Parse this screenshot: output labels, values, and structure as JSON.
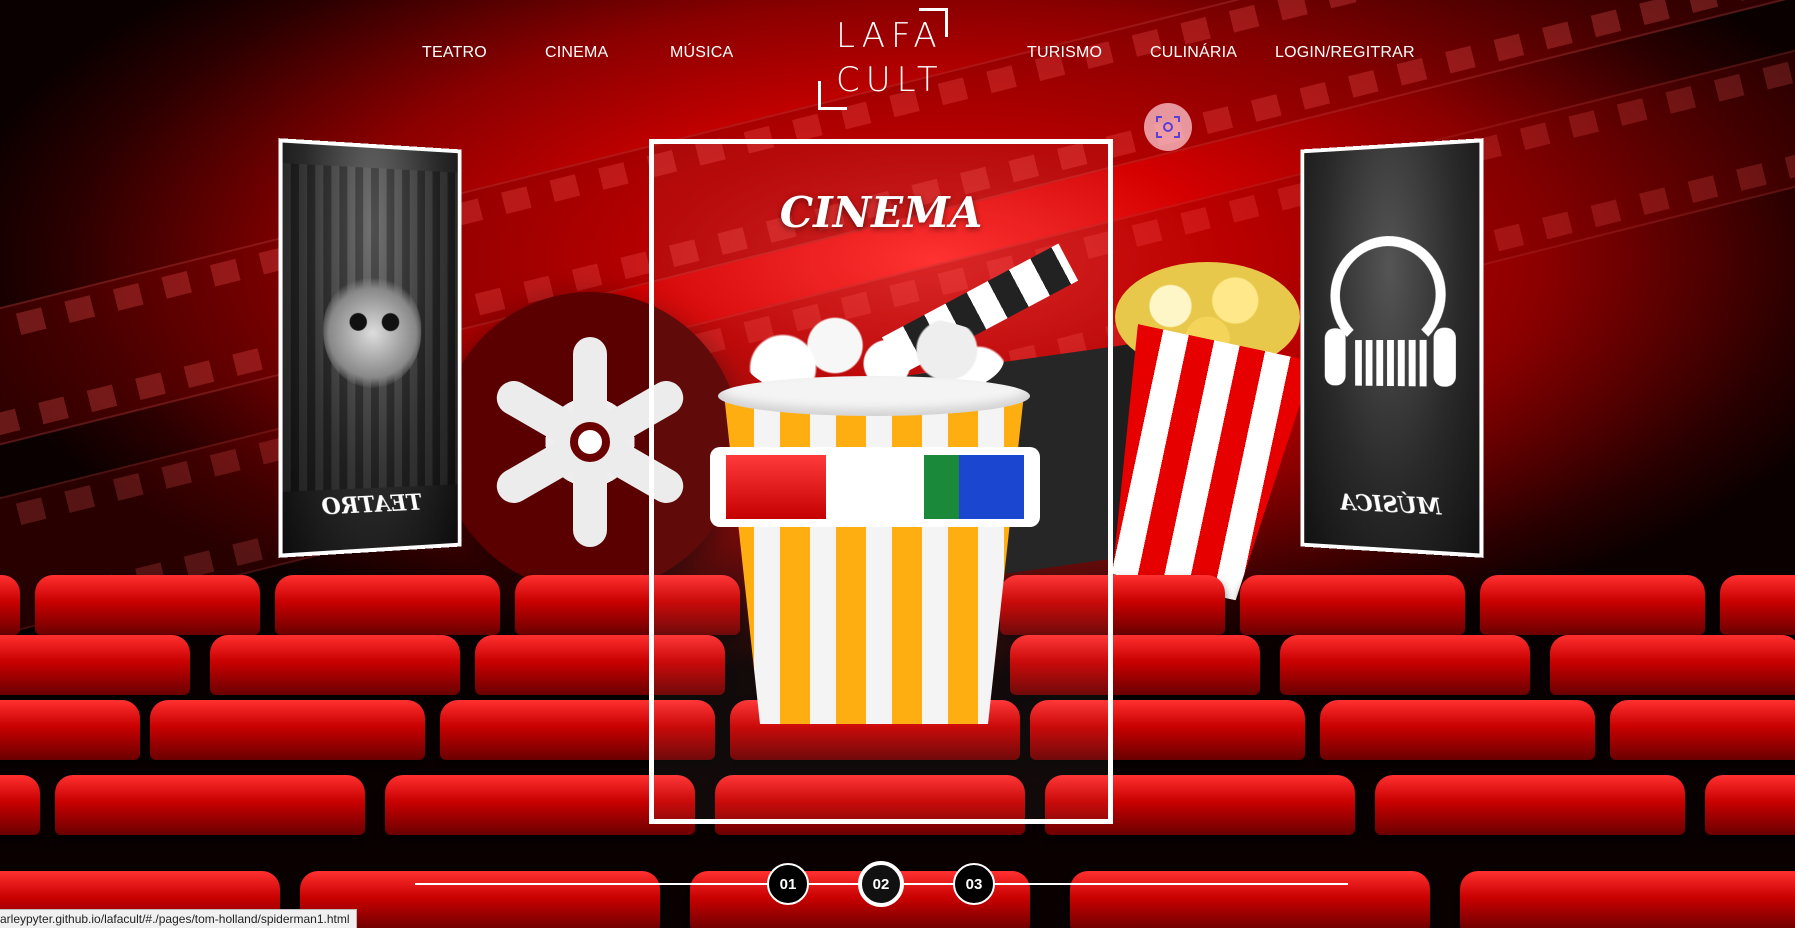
{
  "nav": {
    "left_links": [
      "TEATRO",
      "CINEMA",
      "MÚSICA"
    ],
    "right_links": [
      "TURISMO",
      "CULINÁRIA",
      "LOGIN/REGITRAR"
    ],
    "logo_line1": "LAFA",
    "logo_line2": "CULT"
  },
  "cards": {
    "left_label": "TEATRO",
    "center_title": "CINEMA",
    "right_label": "MÚSICA"
  },
  "pager": [
    "01",
    "02",
    "03"
  ],
  "pager_active_index": 1,
  "status_url": "arleypyter.github.io/lafacult/#./pages/tom-holland/spiderman1.html",
  "colors": {
    "accent": "#d40000",
    "seat": "#c80000",
    "bucket_stripe": "#ffae12"
  }
}
